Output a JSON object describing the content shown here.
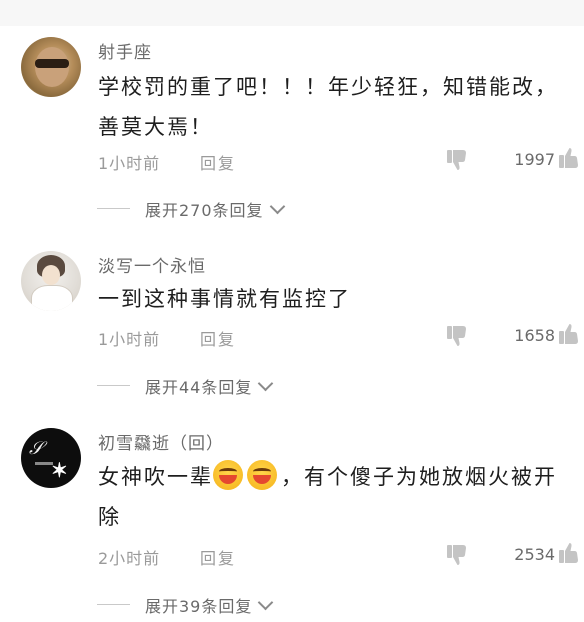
{
  "comments": [
    {
      "username": "射手座",
      "content": "学校罚的重了吧！！！年少轻狂，知错能改，善莫大焉！",
      "time": "1小时前",
      "reply": "回复",
      "likes": "1997",
      "expand": "展开270条回复"
    },
    {
      "username": "淡写一个永恒",
      "content": "一到这种事情就有监控了",
      "time": "1小时前",
      "reply": "回复",
      "likes": "1658",
      "expand": "展开44条回复"
    },
    {
      "username": "初雪飝逝（回）",
      "content_before": "女神吹一辈",
      "content_after": "，有个傻子为她放烟火被开除",
      "emoji_icon": "laughing-emoji-icon",
      "time": "2小时前",
      "reply": "回复",
      "likes": "2534",
      "expand": "展开39条回复"
    }
  ],
  "icons": {
    "dislike": "thumbs-down-icon",
    "like": "thumbs-up-icon",
    "expand": "chevron-down-icon"
  },
  "colors": {
    "username": "#6a6a6a",
    "content": "#1e1e1e",
    "meta": "#9a9a9a",
    "icon": "#c4c4c4"
  }
}
